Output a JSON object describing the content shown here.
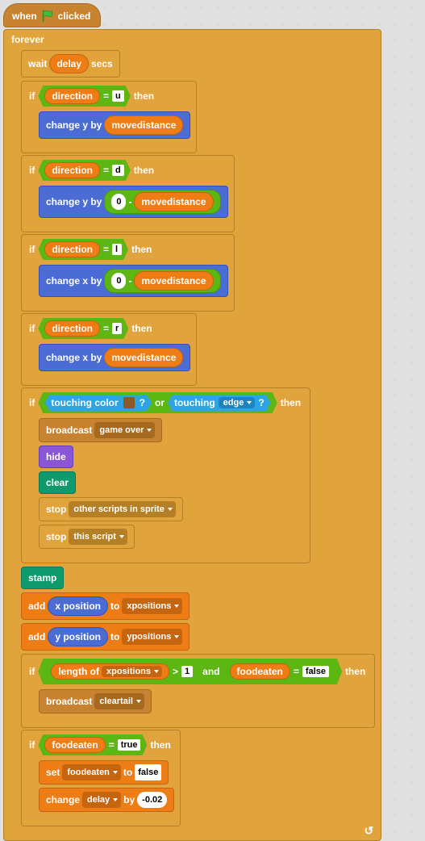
{
  "hat": {
    "prefix": "when",
    "suffix": "clicked"
  },
  "forever": "forever",
  "wait": {
    "label1": "wait",
    "var": "delay",
    "label2": "secs"
  },
  "if": "if",
  "then": "then",
  "direction_var": "direction",
  "eq": "=",
  "dir_u": "u",
  "dir_d": "d",
  "dir_l": "l",
  "dir_r": "r",
  "change_y": "change y by",
  "change_x": "change x by",
  "movedist": "movedistance",
  "zero": "0",
  "minus": "-",
  "touching_color": "touching color",
  "qmark": "?",
  "or": "or",
  "touching": "touching",
  "edge": "edge",
  "broadcast": "broadcast",
  "gameover": "game over",
  "hide": "hide",
  "clear": "clear",
  "stop": "stop",
  "stop1": "other scripts in sprite",
  "stop2": "this script",
  "stamp": "stamp",
  "add": "add",
  "to": "to",
  "xpos": "x position",
  "ypos": "y position",
  "xpositions": "xpositions",
  "ypositions": "ypositions",
  "length_of": "length of",
  "gt": ">",
  "one": "1",
  "and": "and",
  "foodeaten": "foodeaten",
  "false": "false",
  "true": "true",
  "cleartail": "cleartail",
  "set": "set",
  "change": "change",
  "by": "by",
  "neg002": "-0.02",
  "color_swatch": "#8a5a2b"
}
